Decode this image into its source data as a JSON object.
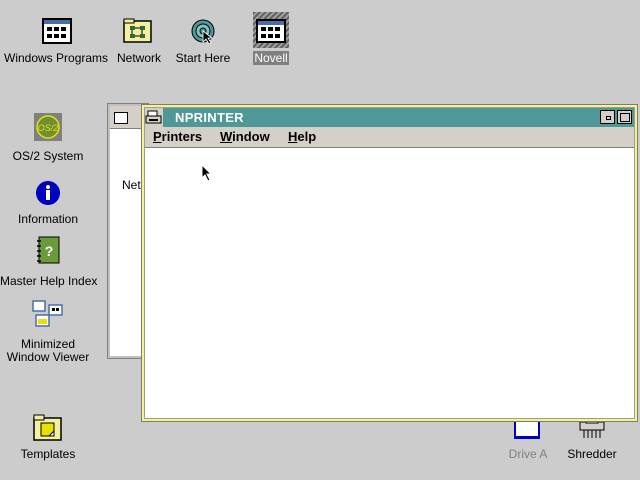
{
  "desktop": {
    "icons": {
      "windows_programs": "Windows Programs",
      "network": "Network",
      "start_here": "Start Here",
      "novell": "Novell",
      "os2_system": "OS/2 System",
      "information": "Information",
      "master_help_index": "Master Help Index",
      "minimized_window_viewer_line1": "Minimized",
      "minimized_window_viewer_line2": "Window Viewer",
      "templates": "Templates",
      "drive_a": "Drive A",
      "shredder": "Shredder"
    }
  },
  "background_window": {
    "partial_text": "Net"
  },
  "nprinter_window": {
    "title": "NPRINTER",
    "menu": {
      "printers_first": "P",
      "printers_rest": "rinters",
      "window_first": "W",
      "window_rest": "indow",
      "help_first": "H",
      "help_rest": "elp"
    }
  },
  "colors": {
    "desktop": "#cccccc",
    "title_bar": "#4f9898",
    "window_frame": "#f4f0a0"
  }
}
